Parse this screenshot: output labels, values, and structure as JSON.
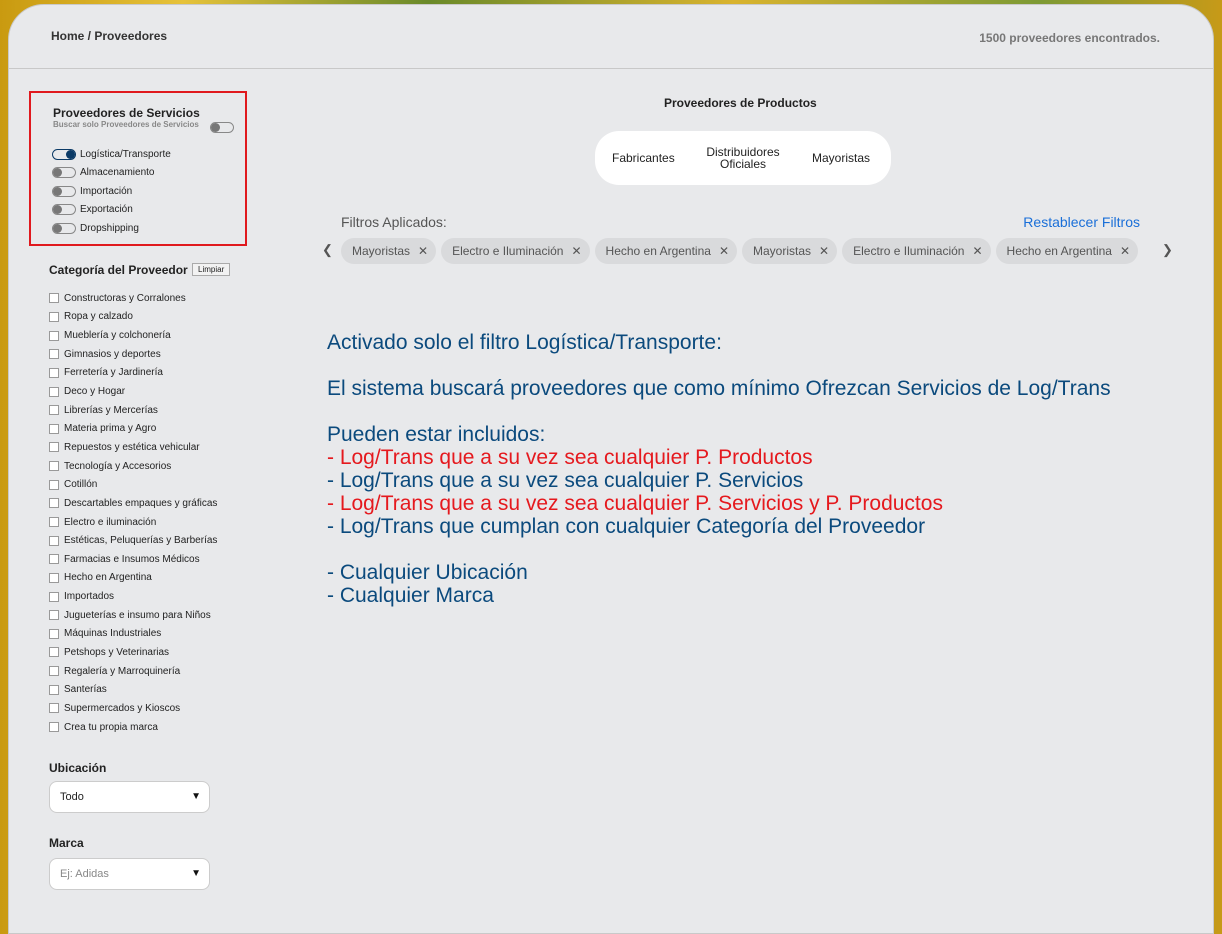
{
  "header": {
    "breadcrumb_home": "Home",
    "breadcrumb_sep": " / ",
    "breadcrumb_current": "Proveedores",
    "results_count": "1500 proveedores encontrados."
  },
  "services": {
    "title": "Proveedores de Servicios",
    "subtitle": "Buscar solo Proveedores de Servicios",
    "only_services_enabled": false,
    "items": [
      {
        "label": "Logística/Transporte",
        "enabled": true
      },
      {
        "label": "Almacenamiento",
        "enabled": false
      },
      {
        "label": "Importación",
        "enabled": false
      },
      {
        "label": "Exportación",
        "enabled": false
      },
      {
        "label": "Dropshipping",
        "enabled": false
      }
    ]
  },
  "categories": {
    "title": "Categoría del Proveedor",
    "clear_label": "Limpiar",
    "items": [
      "Constructoras y Corralones",
      "Ropa y calzado",
      "Mueblería y colchonería",
      "Gimnasios y deportes",
      "Ferretería y Jardinería",
      "Deco y Hogar",
      "Librerías y Mercerías",
      "Materia prima y Agro",
      "Repuestos y estética vehicular",
      "Tecnología y Accesorios",
      "Cotillón",
      "Descartables empaques y gráficas",
      "Electro e iluminación",
      "Estéticas, Peluquerías y Barberías",
      "Farmacias e Insumos Médicos",
      "Hecho en Argentina",
      "Importados",
      "Jugueterías e insumo para Niños",
      "Máquinas Industriales",
      "Petshops y Veterinarias",
      "Regalería y Marroquinería",
      "Santerías",
      "Supermercados y Kioscos",
      "Crea tu propia marca"
    ]
  },
  "location": {
    "title": "Ubicación",
    "value": "Todo"
  },
  "brand": {
    "title": "Marca",
    "placeholder": "Ej: Adidas"
  },
  "products": {
    "title": "Proveedores de Productos",
    "buttons": [
      "Fabricantes",
      "Distribuidores",
      "Oficiales",
      "Mayoristas"
    ]
  },
  "filters": {
    "label": "Filtros Aplicados:",
    "reset_label": "Restablecer Filtros",
    "chips": [
      "Mayoristas",
      "Electro e Iluminación",
      "Hecho en Argentina",
      "Mayoristas",
      "Electro e Iluminación",
      "Hecho en Argentina"
    ]
  },
  "message": {
    "line1": "Activado solo el filtro Logística/Transporte:",
    "line2": "El sistema buscará proveedores que como mínimo Ofrezcan Servicios de Log/Trans",
    "line3": "Pueden estar incluidos:",
    "line4": "- Log/Trans que a su vez sea cualquier P. Productos",
    "line5": "- Log/Trans que a su vez sea cualquier P. Servicios",
    "line6": "- Log/Trans que a su vez sea cualquier P. Servicios y P. Productos",
    "line7": "- Log/Trans que cumplan con cualquier Categoría del Proveedor",
    "line8": "- Cualquier Ubicación",
    "line9": "- Cualquier Marca"
  },
  "colors": {
    "accent_blue": "#0b4a7d",
    "highlight_red": "#e5191e",
    "link_blue": "#1a6fd8"
  }
}
